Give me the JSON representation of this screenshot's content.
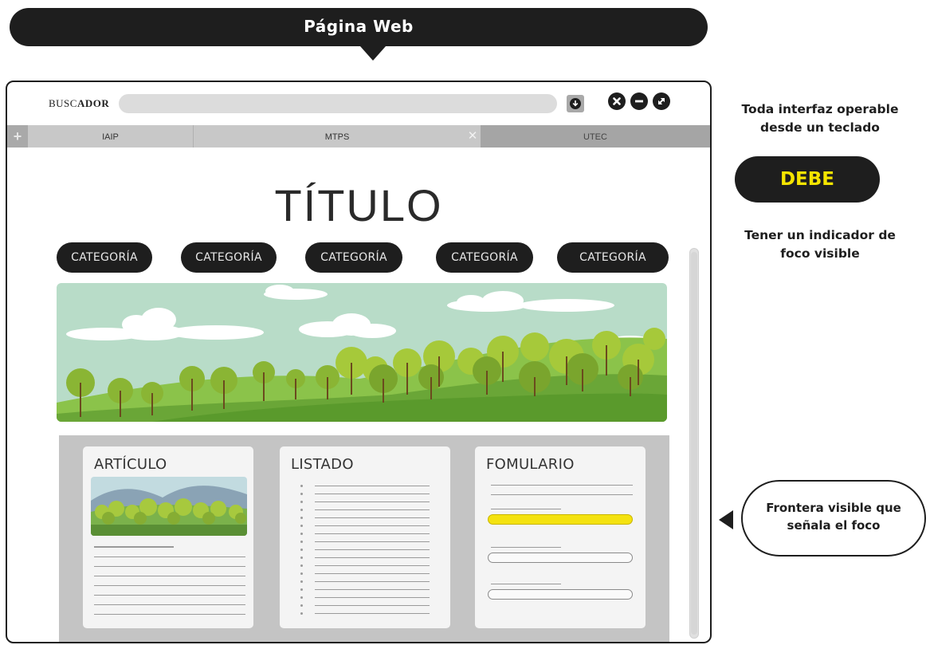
{
  "header": {
    "title": "Página Web"
  },
  "browser": {
    "brand_prefix": "BUSC",
    "brand_suffix": "ADOR",
    "search_value": "",
    "tabs": [
      {
        "label": "IAIP"
      },
      {
        "label": "MTPS"
      },
      {
        "label": "UTEC"
      }
    ],
    "icons": [
      "plus-icon",
      "close-tab-icon",
      "download-icon",
      "close-window-icon",
      "minimize-icon",
      "maximize-icon"
    ]
  },
  "page": {
    "title": "TÍTULO",
    "categories": [
      "CATEGORÍA",
      "CATEGORÍA",
      "CATEGORÍA",
      "CATEGORÍA",
      "CATEGORÍA"
    ],
    "cards": [
      {
        "title": "ARTÍCULO"
      },
      {
        "title": "LISTADO"
      },
      {
        "title": "FOMULARIO"
      }
    ]
  },
  "annotations": {
    "line1": "Toda interfaz operable",
    "line2": "desde un teclado",
    "must": "DEBE",
    "line3": "Tener un indicador de",
    "line4": "foco visible",
    "bubble_line1": "Frontera visible que",
    "bubble_line2": "señala el foco"
  },
  "colors": {
    "dark": "#1e1e1e",
    "focus_yellow": "#f4e20f",
    "must_text": "#f5e400"
  }
}
